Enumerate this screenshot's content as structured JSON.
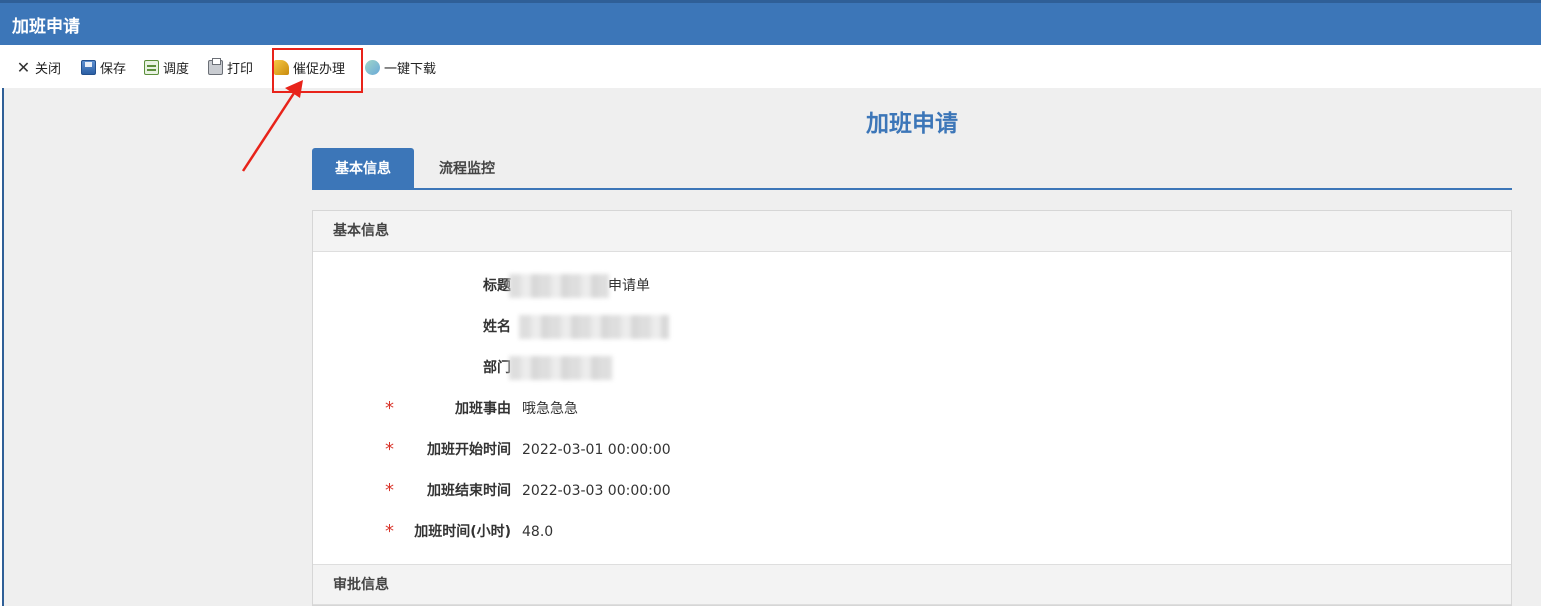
{
  "window": {
    "title": "加班申请"
  },
  "toolbar": {
    "close_label": "关闭",
    "save_label": "保存",
    "schedule_label": "调度",
    "print_label": "打印",
    "urge_label": "催促办理",
    "download_label": "一键下载"
  },
  "page": {
    "title": "加班申请"
  },
  "tabs": [
    {
      "label": "基本信息",
      "active": true
    },
    {
      "label": "流程监控",
      "active": false
    }
  ],
  "basic_info": {
    "section_title": "基本信息",
    "fields": {
      "title": {
        "label": "标题",
        "value": "申请单"
      },
      "name": {
        "label": "姓名",
        "value": ""
      },
      "department": {
        "label": "部门",
        "value": ""
      },
      "reason": {
        "label": "加班事由",
        "value": "哦急急急",
        "required": true
      },
      "start_time": {
        "label": "加班开始时间",
        "value": "2022-03-01 00:00:00",
        "required": true
      },
      "end_time": {
        "label": "加班结束时间",
        "value": "2022-03-03 00:00:00",
        "required": true
      },
      "hours": {
        "label": "加班时间(小时)",
        "value": "48.0",
        "required": true
      }
    }
  },
  "approval_info": {
    "section_title": "审批信息"
  },
  "colors": {
    "primary": "#3c76b8",
    "highlight": "#e8231a",
    "required": "#d9352b",
    "background": "#efefef"
  }
}
